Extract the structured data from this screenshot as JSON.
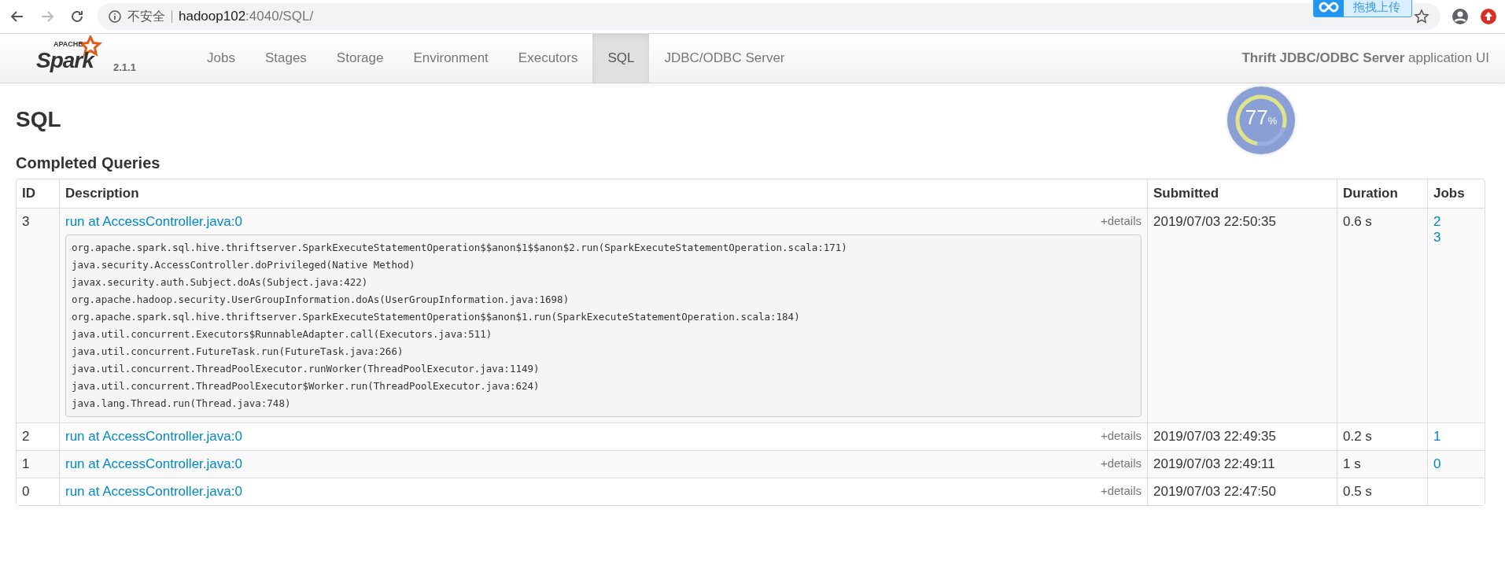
{
  "browser": {
    "security": "不安全",
    "host": "hadoop102",
    "path": ":4040/SQL/",
    "extension_button": "拖拽上传"
  },
  "navbar": {
    "brand": {
      "tagline": "APACHE",
      "name": "Spark",
      "version": "2.1.1"
    },
    "tabs": [
      {
        "label": "Jobs",
        "selected": false
      },
      {
        "label": "Stages",
        "selected": false
      },
      {
        "label": "Storage",
        "selected": false
      },
      {
        "label": "Environment",
        "selected": false
      },
      {
        "label": "Executors",
        "selected": false
      },
      {
        "label": "SQL",
        "selected": true
      },
      {
        "label": "JDBC/ODBC Server",
        "selected": false
      }
    ],
    "app_title": "**Thrift JDBC/ODBC Server** application UI"
  },
  "meter_badge": {
    "value": "77",
    "unit": "%",
    "level": 0.77
  },
  "page_title": "SQL",
  "section_title": "Completed Queries",
  "table": {
    "columns": [
      "ID",
      "Description",
      "Submitted",
      "Duration",
      "Jobs"
    ],
    "rows": [
      {
        "id": "3",
        "description": "run at AccessController.java:0",
        "details": "+details",
        "stack_trace": [
          "org.apache.spark.sql.hive.thriftserver.SparkExecuteStatementOperation$$anon$1$$anon$2.run(SparkExecuteStatementOperation.scala:171)",
          "java.security.AccessController.doPrivileged(Native Method)",
          "javax.security.auth.Subject.doAs(Subject.java:422)",
          "org.apache.hadoop.security.UserGroupInformation.doAs(UserGroupInformation.java:1698)",
          "org.apache.spark.sql.hive.thriftserver.SparkExecuteStatementOperation$$anon$1.run(SparkExecuteStatementOperation.scala:184)",
          "java.util.concurrent.Executors$RunnableAdapter.call(Executors.java:511)",
          "java.util.concurrent.FutureTask.run(FutureTask.java:266)",
          "java.util.concurrent.ThreadPoolExecutor.runWorker(ThreadPoolExecutor.java:1149)",
          "java.util.concurrent.ThreadPoolExecutor$Worker.run(ThreadPoolExecutor.java:624)",
          "java.lang.Thread.run(Thread.java:748)"
        ],
        "submitted": "2019/07/03 22:50:35",
        "duration": "0.6 s",
        "jobs": [
          "2",
          "3"
        ]
      },
      {
        "id": "2",
        "description": "run at AccessController.java:0",
        "details": "+details",
        "submitted": "2019/07/03 22:49:35",
        "duration": "0.2 s",
        "jobs": [
          "1"
        ]
      },
      {
        "id": "1",
        "description": "run at AccessController.java:0",
        "details": "+details",
        "submitted": "2019/07/03 22:49:11",
        "duration": "1 s",
        "jobs": [
          "0"
        ]
      },
      {
        "id": "0",
        "description": "run at AccessController.java:0",
        "details": "+details",
        "submitted": "2019/07/03 22:47:50",
        "duration": "0.5 s",
        "jobs": []
      }
    ]
  }
}
